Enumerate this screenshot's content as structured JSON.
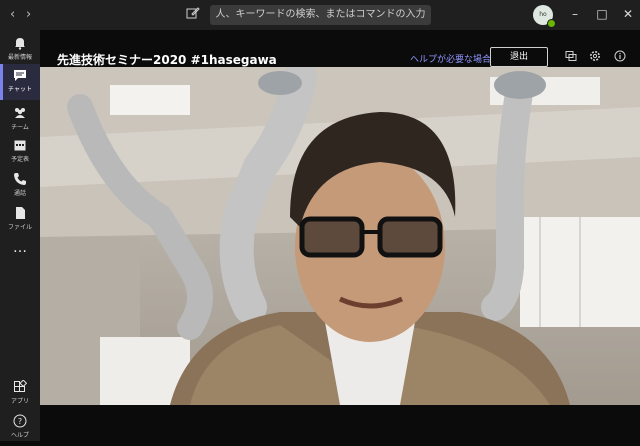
{
  "titlebar": {
    "search_placeholder": "人、キーワードの検索、またはコマンドの入力",
    "avatar_initials": "ho"
  },
  "rail": {
    "items": [
      {
        "label": "最新情報",
        "icon": "bell-icon"
      },
      {
        "label": "チャット",
        "icon": "chat-icon"
      },
      {
        "label": "チーム",
        "icon": "teams-icon"
      },
      {
        "label": "予定表",
        "icon": "calendar-icon"
      },
      {
        "label": "通話",
        "icon": "phone-icon"
      },
      {
        "label": "ファイル",
        "icon": "file-icon"
      },
      {
        "label": "…",
        "icon": "more-icon"
      },
      {
        "label": "アプリ",
        "icon": "apps-icon"
      },
      {
        "label": "ヘルプ",
        "icon": "help-icon"
      }
    ],
    "active_index": 1
  },
  "meeting": {
    "title": "先進技術セミナー2020 #1hasegawa",
    "help_link": "ヘルプが必要な場合",
    "leave_label": "退出"
  },
  "colors": {
    "accent": "#7b83eb",
    "link": "#8f95ff",
    "presence": "#6bb700"
  }
}
